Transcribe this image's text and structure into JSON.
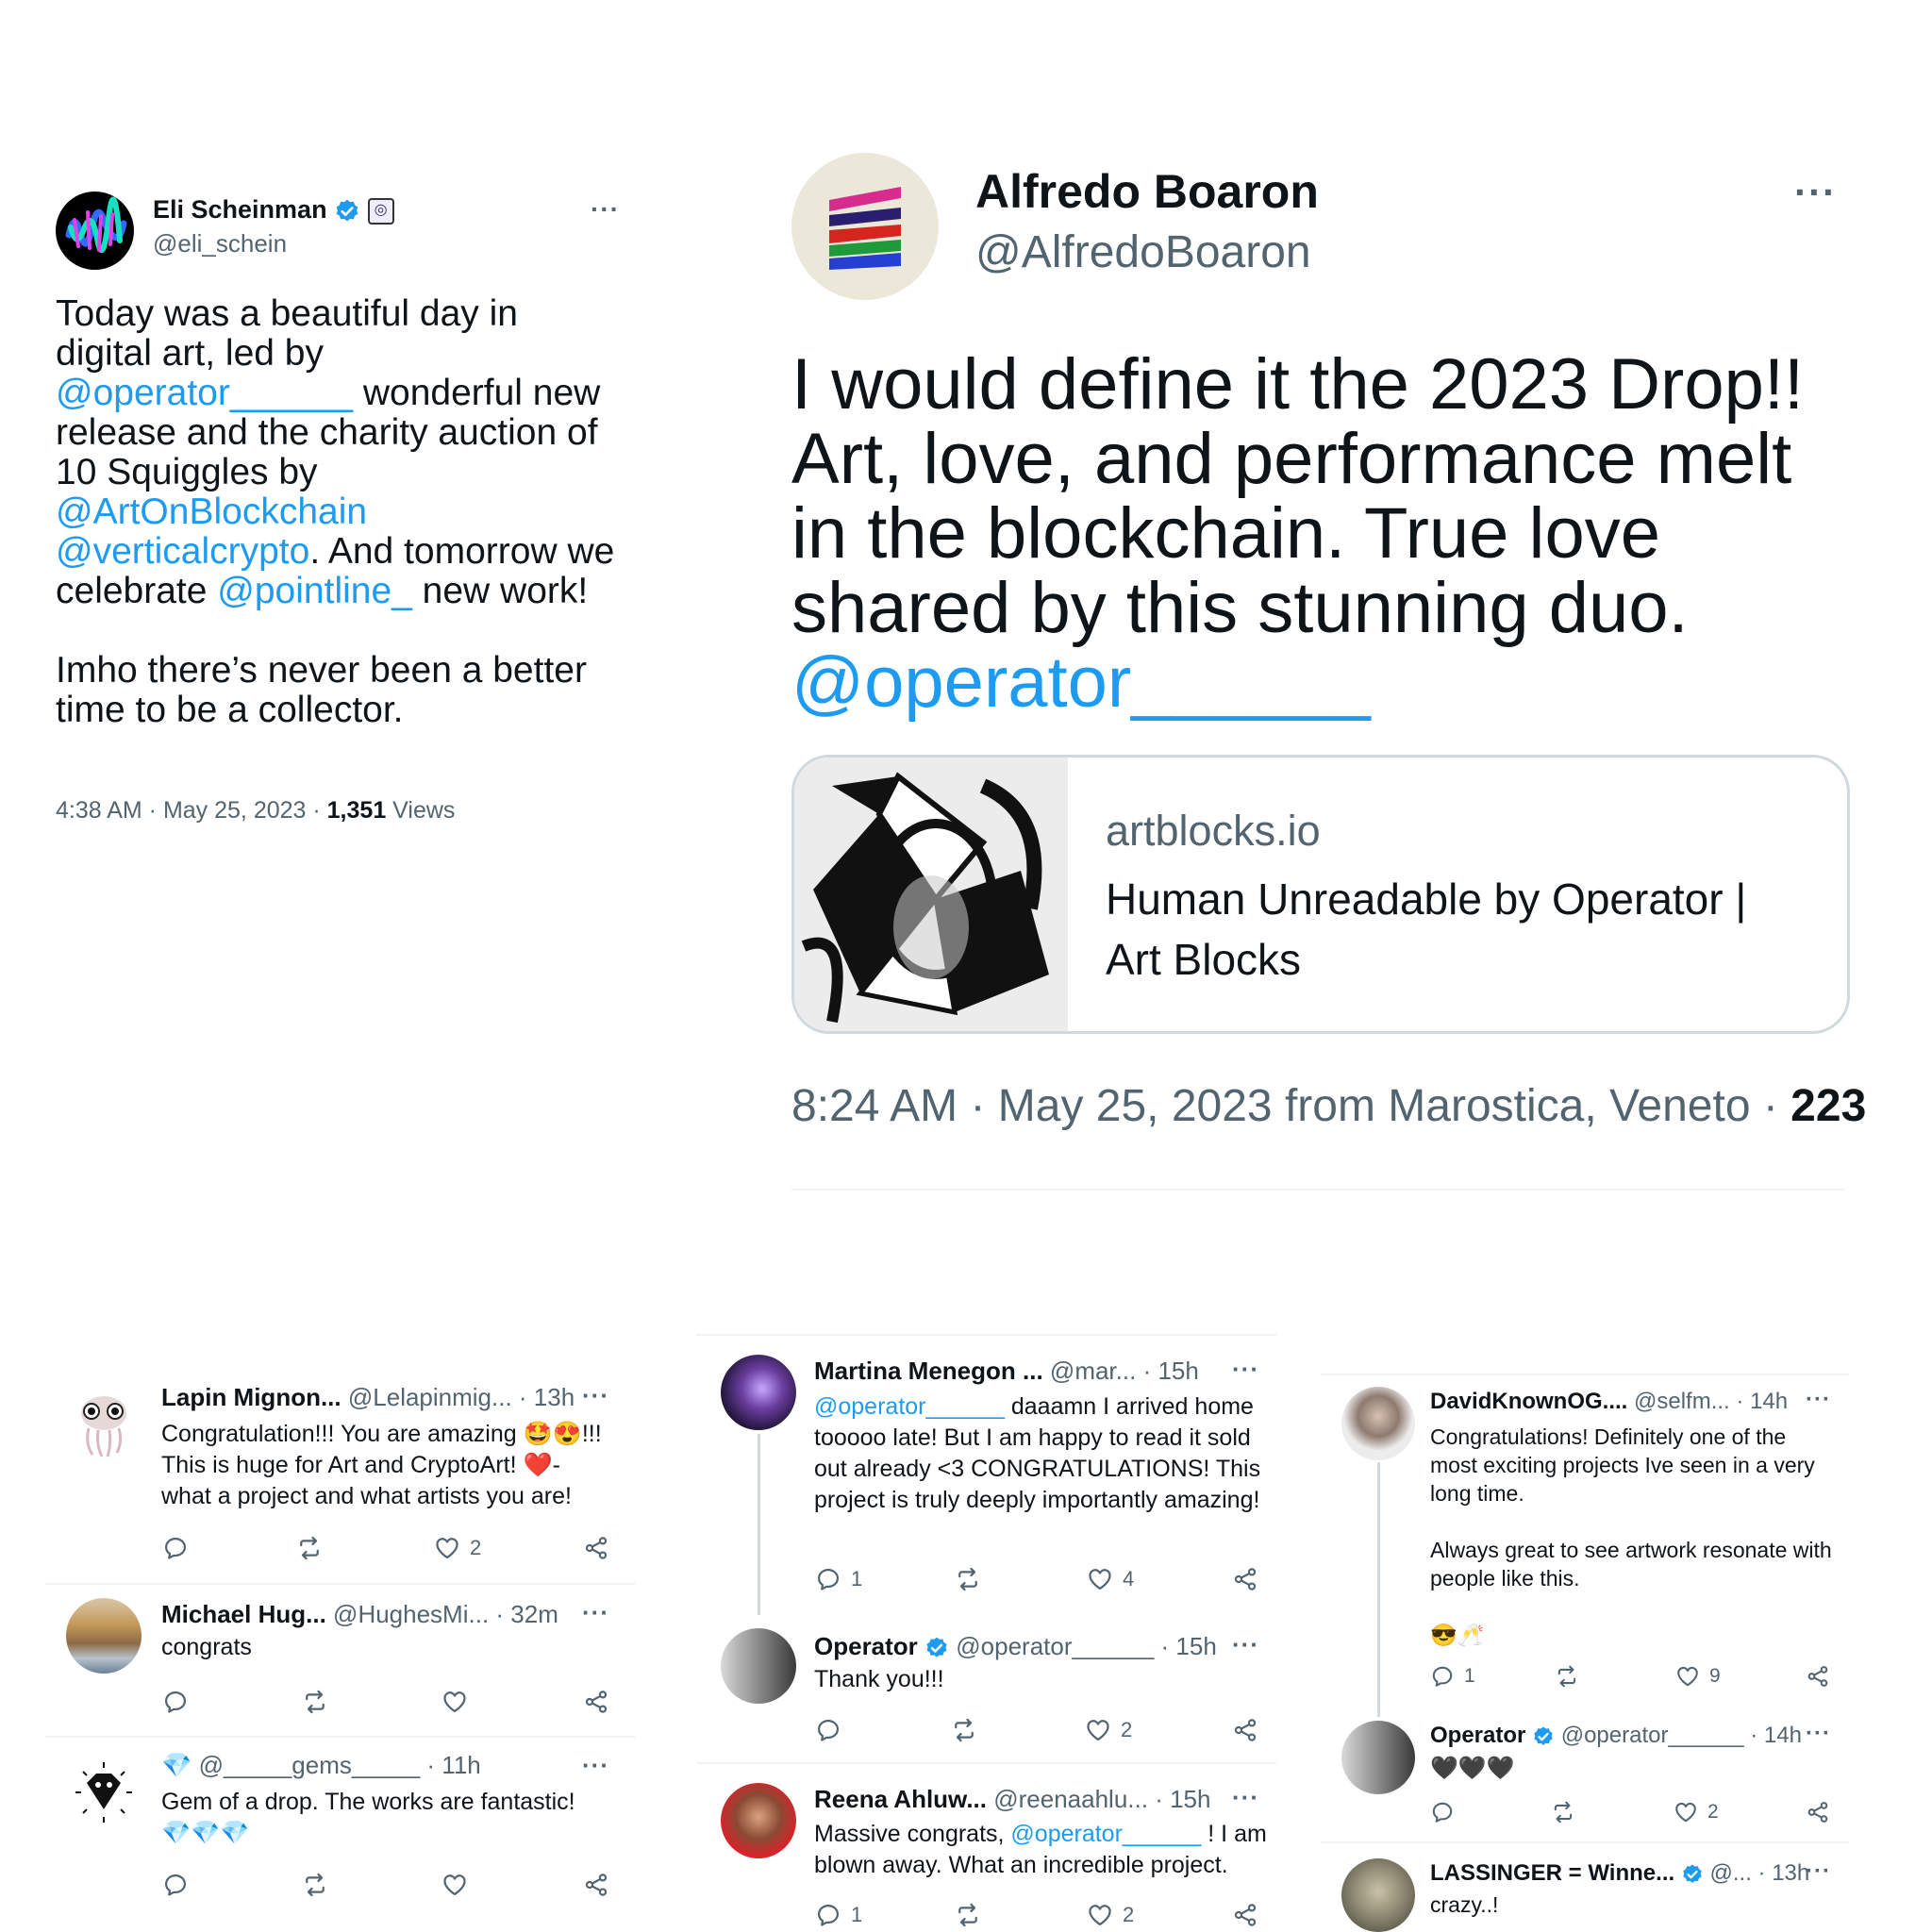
{
  "tweet1": {
    "name": "Eli Scheinman",
    "handle": "@eli_schein",
    "text": {
      "p1": "Today was a beautiful day in digital art, led by",
      "m1": "@operator______",
      "p2": " wonderful new release and the charity auction of 10 Squiggles by ",
      "m2": "@ArtOnBlockchain",
      "m3": "@verticalcrypto",
      "p3": ". And tomorrow we celebrate ",
      "m4": "@pointline_",
      "p4": " new work!",
      "p5": "Imho there’s never been a better time to be a collector."
    },
    "time": "4:38 AM · May 25, 2023 · ",
    "views_count": "1,351",
    "views_label": " Views"
  },
  "tweet2": {
    "name": "Alfredo Boaron",
    "handle": "@AlfredoBoaron",
    "text": "I would define it the 2023 Drop!! Art, love, and performance melt in the blockchain. True love shared by this stunning duo.",
    "mention": "@operator______",
    "card": {
      "domain": "artblocks.io",
      "title": "Human Unreadable by Operator | Art Blocks"
    },
    "meta": "8:24 AM · May 25, 2023 from Marostica, Veneto · ",
    "count": "223"
  },
  "col1": [
    {
      "name": "Lapin Mignon...",
      "handle": "@Lelapinmig...",
      "time": "· 13h",
      "text_a": "Congratulation!!! You are amazing ",
      "emoji_a": "🤩😍",
      "text_b": "!!! This is huge for Art and CryptoArt! ",
      "emoji_b": "❤️",
      "text_c": "- what a project and what artists you are!",
      "likes": "2"
    },
    {
      "name": "Michael Hug...",
      "handle": "@HughesMi...",
      "time": "· 32m",
      "text": "congrats"
    },
    {
      "name_emoji": "💎",
      "handle": "@_____gems_____",
      "time": "· 11h",
      "text": "Gem of a drop. The works are fantastic!",
      "emoji": "💎💎💎"
    }
  ],
  "col2": [
    {
      "name": "Martina Menegon ...",
      "handle": "@mar...",
      "time": "· 15h",
      "mention": "@operator______",
      "text": " daaamn I arrived home tooooo late! But I am happy to read it sold out already <3 CONGRATULATIONS! This project is truly deeply importantly amazing!",
      "replies": "1",
      "likes": "4"
    },
    {
      "name": "Operator",
      "handle": "@operator______",
      "time": "· 15h",
      "text": "Thank you!!!",
      "likes": "2"
    },
    {
      "name": "Reena Ahluw...",
      "handle": "@reenaahlu...",
      "time": "· 15h",
      "text_a": "Massive congrats, ",
      "mention": "@operator______",
      "text_b": " ! I am blown away. What an incredible project.",
      "replies": "1",
      "likes": "2"
    }
  ],
  "col3": [
    {
      "name": "DavidKnownOG....",
      "handle": "@selfm...",
      "time": "· 14h",
      "text_a": "Congratulations! Definitely one of the most exciting projects Ive seen in a very long time.",
      "text_b": "Always great to see artwork resonate with people like this.",
      "emoji": "😎🥂",
      "replies": "1",
      "likes": "9"
    },
    {
      "name": "Operator",
      "handle": "@operator______",
      "time": "· 14h",
      "emoji": "🖤🖤🖤",
      "likes": "2"
    },
    {
      "name": "LASSINGER = Winne...",
      "handle": "@...",
      "time": "· 13h",
      "text": "crazy..!"
    }
  ],
  "icons": {
    "verified": "verified-badge-icon",
    "reply": "reply-icon",
    "retweet": "retweet-icon",
    "like": "heart-icon",
    "share": "share-icon",
    "more": "more-icon"
  },
  "colors": {
    "link": "#1d9bf0",
    "secondary": "#536471",
    "verified": "#1d9bf0",
    "divider": "#eff3f4"
  }
}
